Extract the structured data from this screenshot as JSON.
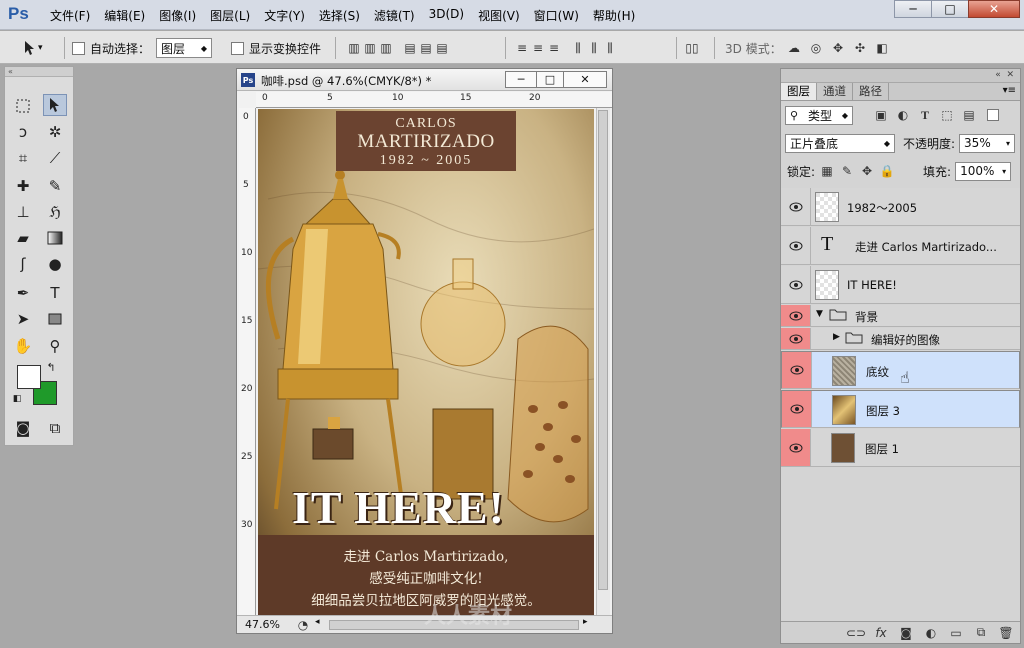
{
  "app": {
    "logo": "Ps"
  },
  "menu": [
    "文件(F)",
    "编辑(E)",
    "图像(I)",
    "图层(L)",
    "文字(Y)",
    "选择(S)",
    "滤镜(T)",
    "3D(D)",
    "视图(V)",
    "窗口(W)",
    "帮助(H)"
  ],
  "window_buttons": {
    "minimize": "─",
    "maximize": "□",
    "close": "✕"
  },
  "options": {
    "auto_select_label": "自动选择：",
    "auto_select_value": "图层",
    "show_transform_label": "显示变换控件",
    "mode3d_label": "3D 模式："
  },
  "document": {
    "title": "咖啡.psd @ 47.6%(CMYK/8*) *",
    "zoom": "47.6%",
    "ruler_h": [
      "0",
      "5",
      "10",
      "15",
      "20"
    ],
    "ruler_v": [
      "0",
      "5",
      "10",
      "15",
      "20",
      "25",
      "30"
    ],
    "art": {
      "brand_line1": "CARLOS",
      "brand_line2": "MARTIRIZADO",
      "brand_years": "1982 ~ 2005",
      "headline": "IT HERE!",
      "copy1": "走进 Carlos Martirizado,",
      "copy2": "感受纯正咖啡文化!",
      "copy3": "细细品尝贝拉地区阿威罗的阳光感觉。",
      "watermark": "人人素材"
    }
  },
  "panel": {
    "tabs": [
      "图层",
      "通道",
      "路径"
    ],
    "filter_kind": "类型",
    "blend_mode": "正片叠底",
    "opacity_label": "不透明度:",
    "opacity_value": "35%",
    "lock_label": "锁定:",
    "fill_label": "填充:",
    "fill_value": "100%",
    "layers": [
      {
        "name": "1982～2005",
        "type": "pixel",
        "selected": false,
        "red": false
      },
      {
        "name": "走进 Carlos Martirizado...",
        "type": "text",
        "selected": false,
        "red": false
      },
      {
        "name": "IT HERE!",
        "type": "pixel",
        "selected": false,
        "red": false
      },
      {
        "name": "背景",
        "type": "group",
        "selected": false,
        "red": true
      },
      {
        "name": "编辑好的图像",
        "type": "group",
        "selected": false,
        "red": true
      },
      {
        "name": "底纹",
        "type": "pixel",
        "selected": true,
        "red": true
      },
      {
        "name": "图层 3",
        "type": "pixel",
        "selected": true,
        "red": true
      },
      {
        "name": "图层 1",
        "type": "pixel",
        "selected": false,
        "red": true
      }
    ]
  },
  "colors": {
    "foreground": "#ffffff",
    "background": "#1f9a2a",
    "selection": "#cfe1fb",
    "label_red": "#f08b8b"
  }
}
